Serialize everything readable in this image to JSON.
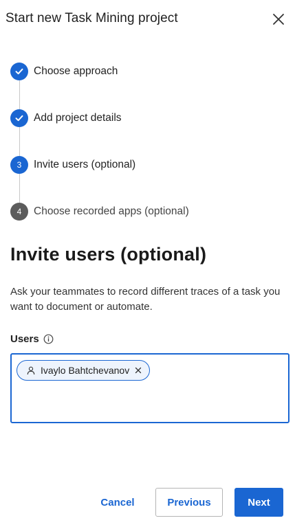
{
  "dialog": {
    "title": "Start new Task Mining project"
  },
  "stepper": {
    "steps": [
      {
        "label": "Choose approach",
        "state": "done",
        "icon": "check-icon"
      },
      {
        "label": "Add project details",
        "state": "done",
        "icon": "check-icon"
      },
      {
        "label": "Invite users (optional)",
        "state": "current",
        "number": "3"
      },
      {
        "label": "Choose recorded apps (optional)",
        "state": "pending",
        "number": "4"
      }
    ]
  },
  "main": {
    "heading": "Invite users (optional)",
    "description": "Ask your teammates to record different traces of a task you want to document or automate.",
    "users_field": {
      "label": "Users",
      "label_icon": "info-icon",
      "chips": [
        {
          "name": "Ivaylo Bahtchevanov",
          "icon": "user-icon",
          "remove_icon": "close-icon"
        }
      ]
    }
  },
  "footer": {
    "cancel_label": "Cancel",
    "previous_label": "Previous",
    "next_label": "Next"
  },
  "colors": {
    "accent": "#1a66d2",
    "pending_step": "#5c5c5c",
    "text": "#222222"
  }
}
